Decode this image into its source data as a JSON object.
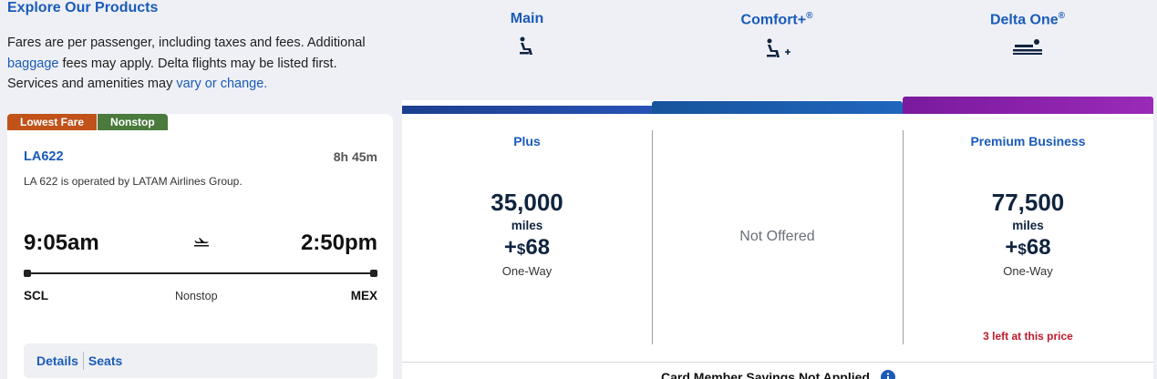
{
  "explore": {
    "title": "Explore Our Products",
    "desc_part1": "Fares are per passenger, including taxes and fees. Additional",
    "baggage_link": "baggage",
    "desc_part2": " fees may apply. Delta flights may be listed first.",
    "desc_part3": "Services and amenities may ",
    "vary_link": "vary or change."
  },
  "cabins": [
    {
      "name": "Main",
      "icon": "seat-icon"
    },
    {
      "name": "Comfort+",
      "sup": "®",
      "icon": "seat-plus-icon"
    },
    {
      "name": "Delta One",
      "sup": "®",
      "icon": "lie-flat-seat-icon"
    }
  ],
  "badges": {
    "lowest_fare": "Lowest Fare",
    "nonstop": "Nonstop"
  },
  "flight": {
    "number": "LA622",
    "duration": "8h 45m",
    "operator": "LA 622 is operated by LATAM Airlines Group.",
    "depart_time": "9:05am",
    "arrive_time": "2:50pm",
    "origin": "SCL",
    "destination": "MEX",
    "stop_type": "Nonstop",
    "details_label": "Details",
    "seats_label": "Seats"
  },
  "fares": {
    "main": {
      "name": "Plus",
      "miles": "35,000",
      "miles_label": "miles",
      "tax_prefix": "+",
      "currency": "$",
      "tax": "68",
      "trip": "One-Way"
    },
    "comfort": {
      "not_offered": "Not Offered"
    },
    "delta_one": {
      "name": "Premium Business",
      "miles": "77,500",
      "miles_label": "miles",
      "tax_prefix": "+",
      "currency": "$",
      "tax": "68",
      "trip": "One-Way",
      "seats_left": "3 left at this price"
    }
  },
  "card_savings": "Card Member Savings Not Applied",
  "colors": {
    "brand_blue": "#1b5bb8",
    "navy": "#10243f",
    "alert_red": "#c01a2c",
    "lowest_fare": "#c1521a",
    "nonstop": "#4a7a3c",
    "delta_one_purple": "#7a1a9c"
  }
}
